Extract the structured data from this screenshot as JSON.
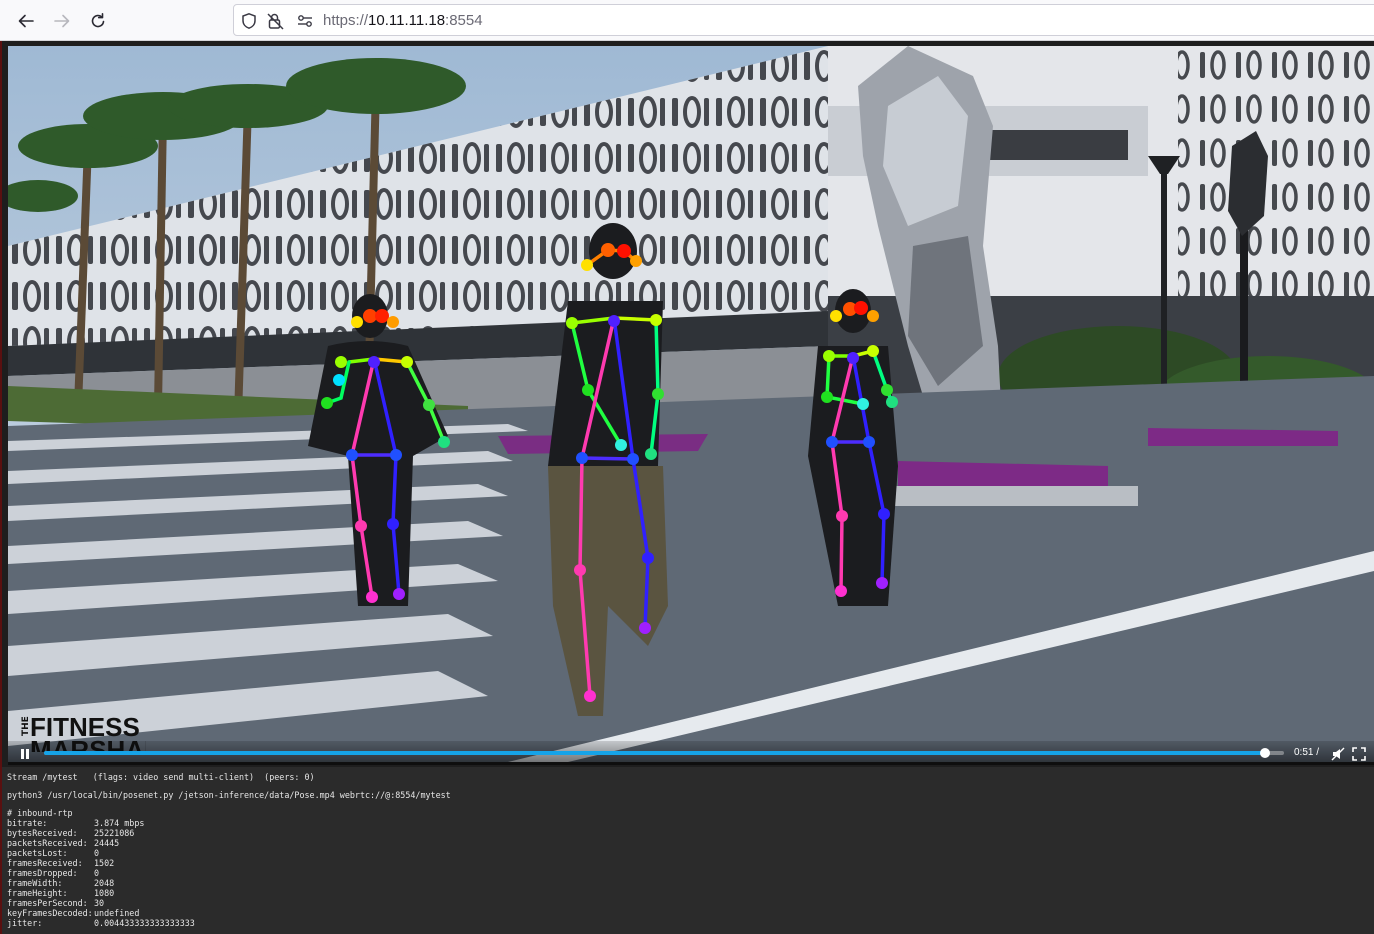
{
  "browser": {
    "url_protocol": "https://",
    "url_host": "10.11.11.18",
    "url_port": ":8554",
    "icons": [
      "back-arrow-icon",
      "forward-arrow-icon",
      "reload-icon",
      "shield-icon",
      "lock-icon",
      "permissions-icon"
    ]
  },
  "video": {
    "watermark_small": "THE",
    "watermark_big": "FITNESS",
    "watermark_sub": "MARSHALL",
    "time_display": "0:51 /",
    "progress": 0.985,
    "colors": {
      "seek_fill": "#16a3e8"
    }
  },
  "console": {
    "stream_line": "Stream /mytest   (flags: video send multi-client)  (peers: 0)",
    "command_line": "python3 /usr/local/bin/posenet.py /jetson-inference/data/Pose.mp4 webrtc://@:8554/mytest",
    "section_header": "# inbound-rtp",
    "stats": [
      {
        "key": "bitrate:",
        "value": "3.874 mbps"
      },
      {
        "key": "bytesReceived:",
        "value": "25221086"
      },
      {
        "key": "packetsReceived:",
        "value": "24445"
      },
      {
        "key": "packetsLost:",
        "value": "0"
      },
      {
        "key": "framesReceived:",
        "value": "1502"
      },
      {
        "key": "framesDropped:",
        "value": "0"
      },
      {
        "key": "frameWidth:",
        "value": "2048"
      },
      {
        "key": "frameHeight:",
        "value": "1080"
      },
      {
        "key": "framesPerSecond:",
        "value": "30"
      },
      {
        "key": "keyFramesDecoded:",
        "value": "undefined"
      },
      {
        "key": "jitter:",
        "value": "0.004433333333333333"
      }
    ]
  }
}
